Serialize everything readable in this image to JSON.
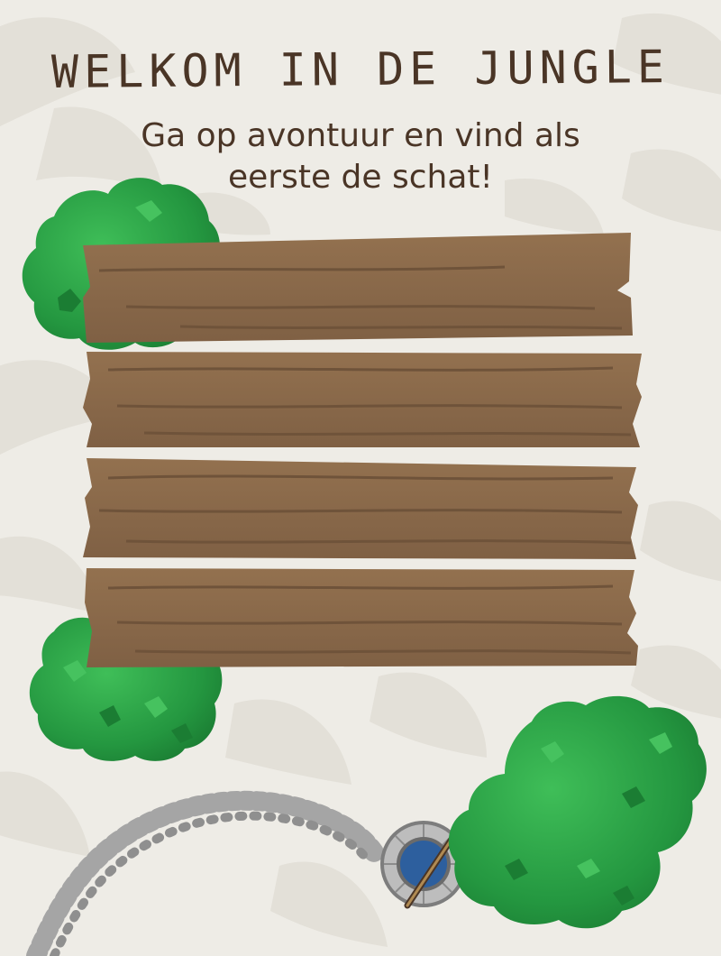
{
  "title": "WELKOM IN DE JUNGLE",
  "subtitle": "Ga op avontuur en vind als eerste de schat!",
  "colors": {
    "background": "#eeece6",
    "leaf_pattern": "#e2dfd7",
    "wood": "#8a6a4c",
    "wood_grain": "#6f533a",
    "bush": "#2c9b44",
    "bush_dark": "#1c7a32",
    "bush_light": "#44c05c",
    "stone": "#9a9a9a",
    "well_water": "#2d5f9e",
    "text": "#4a3526"
  }
}
